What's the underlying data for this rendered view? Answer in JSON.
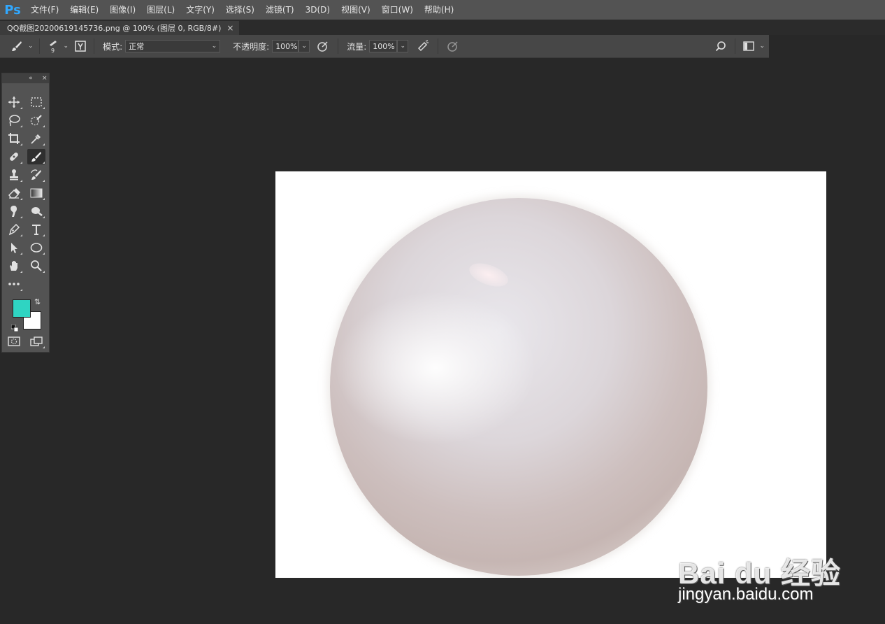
{
  "app": {
    "logo": "Ps"
  },
  "menu": [
    "文件(F)",
    "编辑(E)",
    "图像(I)",
    "图层(L)",
    "文字(Y)",
    "选择(S)",
    "滤镜(T)",
    "3D(D)",
    "视图(V)",
    "窗口(W)",
    "帮助(H)"
  ],
  "document_tab": {
    "title": "QQ截图20200619145736.png @ 100% (图层 0, RGB/8#)",
    "close": "×"
  },
  "options": {
    "brush_size": "9",
    "mode_label": "模式:",
    "mode_value": "正常",
    "opacity_label": "不透明度:",
    "opacity_value": "100%",
    "flow_label": "流量:",
    "flow_value": "100%"
  },
  "colors": {
    "foreground": "#2fd4c2",
    "background": "#ffffff",
    "accent": "#31a8ff"
  },
  "tools": [
    "move-icon",
    "marquee-icon",
    "lasso-icon",
    "quick-select-icon",
    "crop-icon",
    "eyedropper-icon",
    "healing-icon",
    "brush-icon",
    "stamp-icon",
    "history-brush-icon",
    "eraser-icon",
    "gradient-icon",
    "blur-icon",
    "dodge-icon",
    "pen-icon",
    "type-icon",
    "path-select-icon",
    "ellipse-icon",
    "hand-icon",
    "zoom-icon",
    "more-icon"
  ],
  "watermark": {
    "brand": "Bai du 经验",
    "url": "jingyan.baidu.com"
  }
}
